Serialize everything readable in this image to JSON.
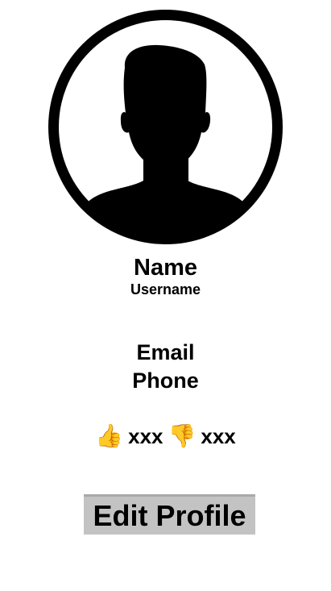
{
  "profile": {
    "name": "Name",
    "username": "Username",
    "email": "Email",
    "phone": "Phone",
    "avatar_icon": "user-silhouette-icon"
  },
  "ratings": {
    "likes_icon": "thumbs-up-icon",
    "likes_count": "xxx",
    "dislikes_icon": "thumbs-down-icon",
    "dislikes_count": "xxx",
    "thumb_color": "#f5b53a"
  },
  "actions": {
    "edit_profile_label": "Edit Profile",
    "button_color": "#c3c3c3"
  }
}
